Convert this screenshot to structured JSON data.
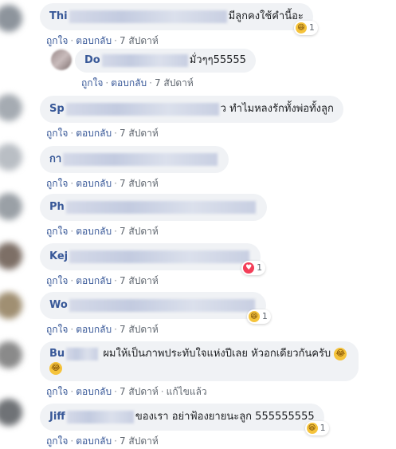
{
  "actions": {
    "like": "ถูกใจ",
    "reply": "ตอบกลับ",
    "time": "7 สัปดาห์",
    "edited": "แก้ไขแล้ว"
  },
  "comments": [
    {
      "name": "Thi",
      "text": "มีลูกคงใช้คำนี้อะ",
      "reaction": {
        "type": "haha",
        "count": "1"
      }
    },
    {
      "name": "Do",
      "text": "มั่วๆๆ55555",
      "reply": true
    },
    {
      "name": "Sp",
      "text": "ว ทำไมหลงรักทั้งพ่อทั้งลูก"
    },
    {
      "name": "กา",
      "text": ""
    },
    {
      "name": "Ph",
      "text": ""
    },
    {
      "name": "Kej",
      "text": "",
      "reaction": {
        "type": "love",
        "count": "1"
      }
    },
    {
      "name": "Wo",
      "text": "",
      "reaction": {
        "type": "haha",
        "count": "1"
      }
    },
    {
      "name": "Bu",
      "text": "ผมให้เป็นภาพประทับใจแห่งปีเลย หัวอกเดียวกันครับ",
      "edited": true
    },
    {
      "name": "Jiff",
      "text": "ของเรา อย่าฟ้องยายนะลูก 555555555",
      "reaction": {
        "type": "haha",
        "count": "1"
      }
    }
  ],
  "icons": {
    "haha": "haha-icon",
    "love": "love-icon",
    "laugh_emoji": "laughing-emoji-icon"
  },
  "colors": {
    "name": "#385898",
    "bubble": "#f0f2f5",
    "meta": "#606770",
    "love": "#f33e58",
    "haha": "#f5c33b"
  }
}
